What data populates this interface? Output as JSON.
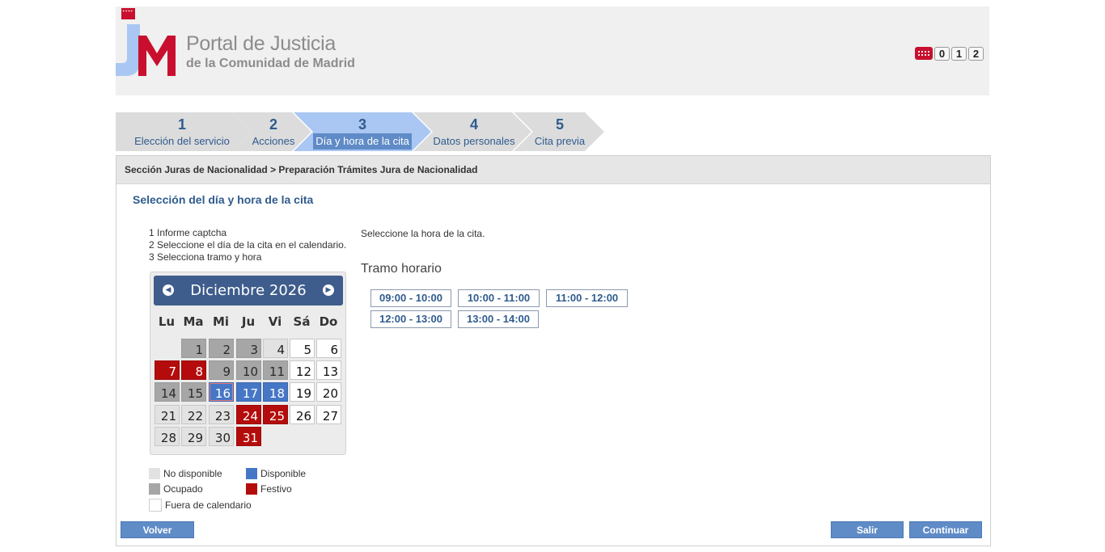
{
  "header": {
    "title": "Portal de Justicia",
    "subtitle": "de la Comunidad de Madrid",
    "emergency_digits": [
      "0",
      "1",
      "2"
    ]
  },
  "steps": [
    {
      "num": "1",
      "label": "Elección del servicio",
      "active": false
    },
    {
      "num": "2",
      "label": "Acciones",
      "active": false
    },
    {
      "num": "3",
      "label": "Día y hora de la cita",
      "active": true
    },
    {
      "num": "4",
      "label": "Datos personales",
      "active": false
    },
    {
      "num": "5",
      "label": "Cita previa",
      "active": false
    }
  ],
  "breadcrumb": "Sección Juras de Nacionalidad > Preparación Trámites Jura de Nacionalidad",
  "section_title": "Selección del día y hora de la cita",
  "instructions": [
    "1 Informe captcha",
    "2 Seleccione el día de la cita en el calendario.",
    "3 Selecciona tramo y hora"
  ],
  "calendar": {
    "month_title": "Diciembre 2026",
    "weekdays": [
      "Lu",
      "Ma",
      "Mi",
      "Ju",
      "Vi",
      "Sá",
      "Do"
    ],
    "selected_day": "16",
    "days": [
      {
        "d": "1",
        "s": "oc"
      },
      {
        "d": "2",
        "s": "oc"
      },
      {
        "d": "3",
        "s": "oc"
      },
      {
        "d": "4",
        "s": "nd"
      },
      {
        "d": "5",
        "s": "fc"
      },
      {
        "d": "6",
        "s": "fc"
      },
      {
        "d": "7",
        "s": "fe"
      },
      {
        "d": "8",
        "s": "fe"
      },
      {
        "d": "9",
        "s": "oc"
      },
      {
        "d": "10",
        "s": "oc"
      },
      {
        "d": "11",
        "s": "oc"
      },
      {
        "d": "12",
        "s": "fc"
      },
      {
        "d": "13",
        "s": "fc"
      },
      {
        "d": "14",
        "s": "oc"
      },
      {
        "d": "15",
        "s": "oc"
      },
      {
        "d": "16",
        "s": "di"
      },
      {
        "d": "17",
        "s": "di"
      },
      {
        "d": "18",
        "s": "di"
      },
      {
        "d": "19",
        "s": "fc"
      },
      {
        "d": "20",
        "s": "fc"
      },
      {
        "d": "21",
        "s": "nd"
      },
      {
        "d": "22",
        "s": "nd"
      },
      {
        "d": "23",
        "s": "nd"
      },
      {
        "d": "24",
        "s": "fe"
      },
      {
        "d": "25",
        "s": "fe"
      },
      {
        "d": "26",
        "s": "fc"
      },
      {
        "d": "27",
        "s": "fc"
      },
      {
        "d": "28",
        "s": "nd"
      },
      {
        "d": "29",
        "s": "nd"
      },
      {
        "d": "30",
        "s": "nd"
      },
      {
        "d": "31",
        "s": "fe"
      }
    ]
  },
  "legend": {
    "no_disponible": "No disponible",
    "disponible": "Disponible",
    "ocupado": "Ocupado",
    "festivo": "Festivo",
    "fuera": "Fuera de calendario"
  },
  "colors": {
    "no_disponible": "#e2e2e2",
    "disponible": "#4677c7",
    "ocupado": "#a6a6a6",
    "festivo": "#b40c0c",
    "fuera": "#ffffff",
    "accent": "#2f5b8e"
  },
  "hora_text": "Seleccione la hora de la cita.",
  "tramo_title": "Tramo horario",
  "slots": [
    "09:00 - 10:00",
    "10:00 - 11:00",
    "11:00 - 12:00",
    "12:00 - 13:00",
    "13:00 - 14:00"
  ],
  "buttons": {
    "volver": "Volver",
    "salir": "Salir",
    "continuar": "Continuar"
  }
}
